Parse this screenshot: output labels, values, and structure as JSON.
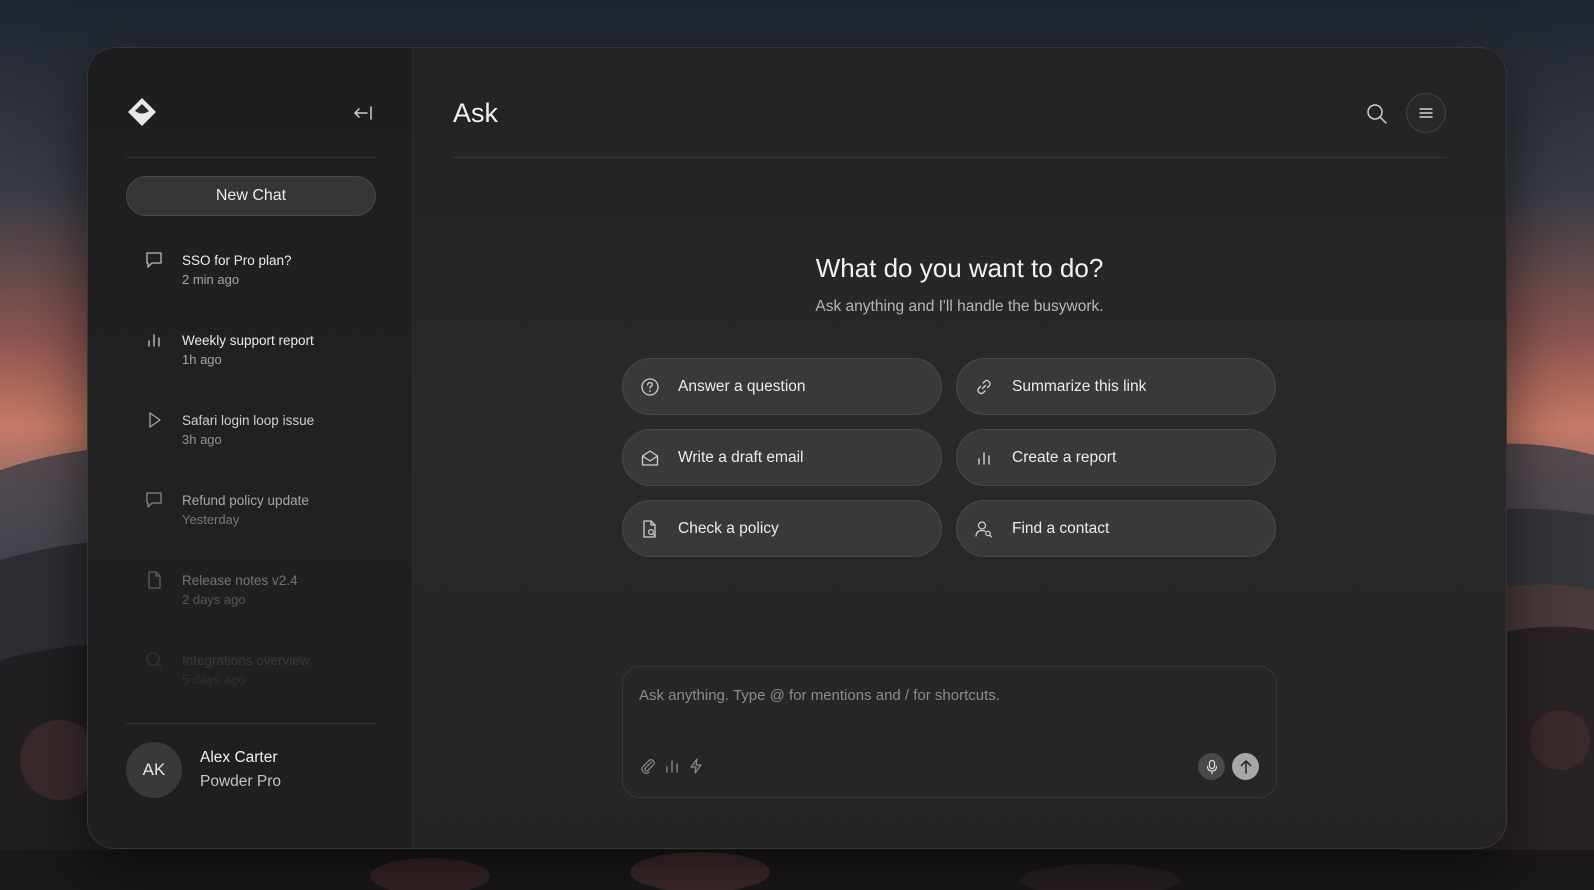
{
  "sidebar": {
    "new_chat_label": "New Chat",
    "history": [
      {
        "icon": "chat-bubble-icon",
        "title": "SSO for Pro plan?",
        "time": "2 min ago",
        "opacity": 1
      },
      {
        "icon": "bar-chart-icon",
        "title": "Weekly support report",
        "time": "1h ago",
        "opacity": 1
      },
      {
        "icon": "play-icon",
        "title": "Safari login loop issue",
        "time": "3h ago",
        "opacity": 0.85
      },
      {
        "icon": "chat-bubble-icon",
        "title": "Refund policy update",
        "time": "Yesterday",
        "opacity": 0.65
      },
      {
        "icon": "document-icon",
        "title": "Release notes v2.4",
        "time": "2 days ago",
        "opacity": 0.4
      },
      {
        "icon": "search-icon",
        "title": "Integrations overview",
        "time": "5 days ago",
        "opacity": 0.12
      }
    ],
    "user": {
      "initials": "AK",
      "name": "Alex Carter",
      "plan": "Powder Pro"
    }
  },
  "header": {
    "title": "Ask"
  },
  "hero": {
    "title": "What do you want to do?",
    "subtitle": "Ask anything and I'll handle the busywork."
  },
  "actions": [
    {
      "icon": "question-circle-icon",
      "label": "Answer a question"
    },
    {
      "icon": "link-icon",
      "label": "Summarize this link"
    },
    {
      "icon": "mail-icon",
      "label": "Write a draft email"
    },
    {
      "icon": "bar-chart-icon",
      "label": "Create a report"
    },
    {
      "icon": "policy-document-icon",
      "label": "Check a policy"
    },
    {
      "icon": "person-search-icon",
      "label": "Find a contact"
    }
  ],
  "composer": {
    "placeholder": "Ask anything. Type @ for mentions and / for shortcuts.",
    "value": ""
  },
  "colors": {
    "window_bg": "#262524",
    "button_bg": "#3a3938",
    "text": "#ececec",
    "muted": "#a7a5a3",
    "send_bg": "#a9a7a5"
  }
}
